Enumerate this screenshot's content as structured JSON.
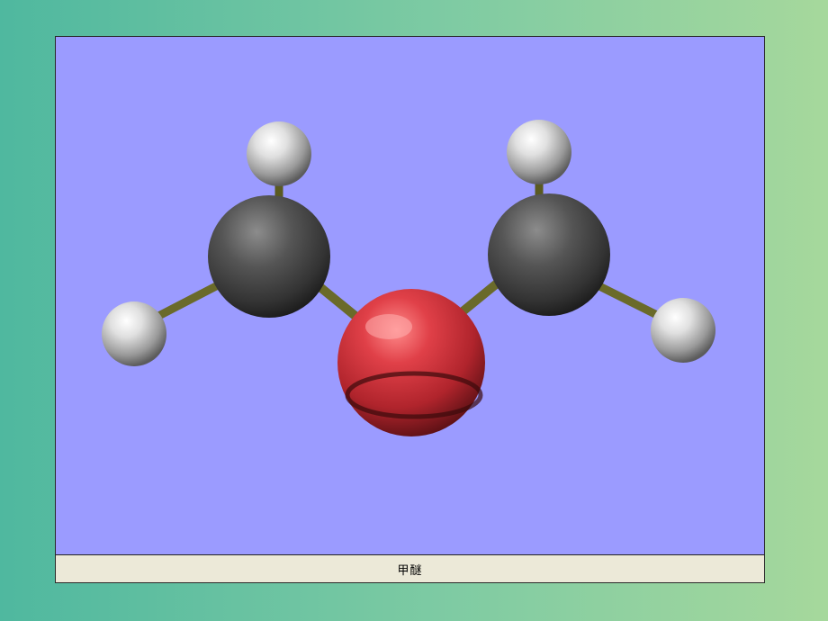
{
  "caption": {
    "label": "甲醚"
  },
  "molecule": {
    "atoms": [
      {
        "element": "H",
        "role": "methyl-left-top-hydrogen"
      },
      {
        "element": "C",
        "role": "methyl-left-carbon"
      },
      {
        "element": "H",
        "role": "methyl-left-outer-hydrogen"
      },
      {
        "element": "O",
        "role": "bridging-oxygen"
      },
      {
        "element": "C",
        "role": "methyl-right-carbon"
      },
      {
        "element": "H",
        "role": "methyl-right-top-hydrogen"
      },
      {
        "element": "H",
        "role": "methyl-right-outer-hydrogen"
      }
    ],
    "colors": {
      "background": "#9b9bff",
      "hydrogen": "#d9d9d9",
      "carbon": "#4a4a4a",
      "oxygen": "#d8343c",
      "bond": "#6a6a2a"
    }
  }
}
